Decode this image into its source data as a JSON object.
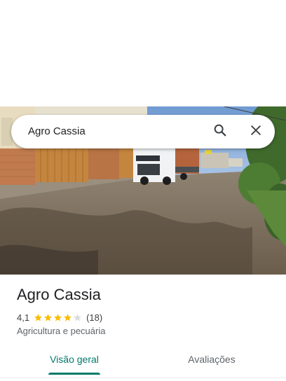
{
  "search": {
    "value": "Agro Cassia"
  },
  "place": {
    "name": "Agro Cassia",
    "rating": "4,1",
    "rating_value": 4.1,
    "max_stars": 5,
    "review_count": "(18)",
    "category": "Agricultura e pecuária"
  },
  "tabs": [
    {
      "label": "Visão geral",
      "active": true
    },
    {
      "label": "Avaliações",
      "active": false
    }
  ],
  "colors": {
    "accent": "#00796b",
    "star": "#fbbc04",
    "star_empty": "#dadce0"
  },
  "icons": {
    "search": "search-icon",
    "close": "close-icon"
  }
}
